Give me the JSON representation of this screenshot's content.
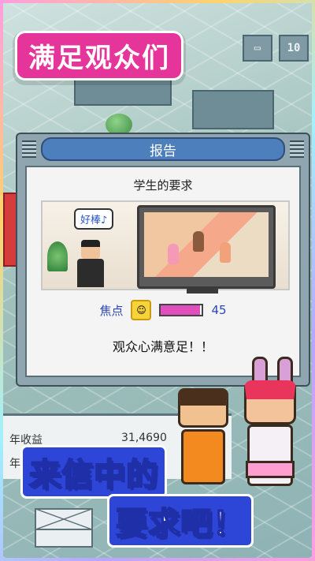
{
  "promo": {
    "top_title": "满足观众们",
    "bottom_line1": "来信中的",
    "bottom_line2": "要求吧！"
  },
  "hud": {
    "counter": "10"
  },
  "report": {
    "title": "报告",
    "subtitle": "学生的要求",
    "speech": "好棒♪",
    "stat_label": "焦点",
    "stat_value": "45",
    "stat_fill": 0.95,
    "message": "观众心满意足！！"
  },
  "panel": {
    "row1_label": "年收益",
    "row1_value": "31,4690",
    "row2_label": "年"
  },
  "colors": {
    "accent_pink": "#e5349a",
    "accent_blue": "#2d46d8",
    "dialog_header": "#4e7fbd",
    "stat_bar": "#e14fbf"
  },
  "icons": [
    "monitor-icon",
    "smiley-icon",
    "mail-icon"
  ]
}
